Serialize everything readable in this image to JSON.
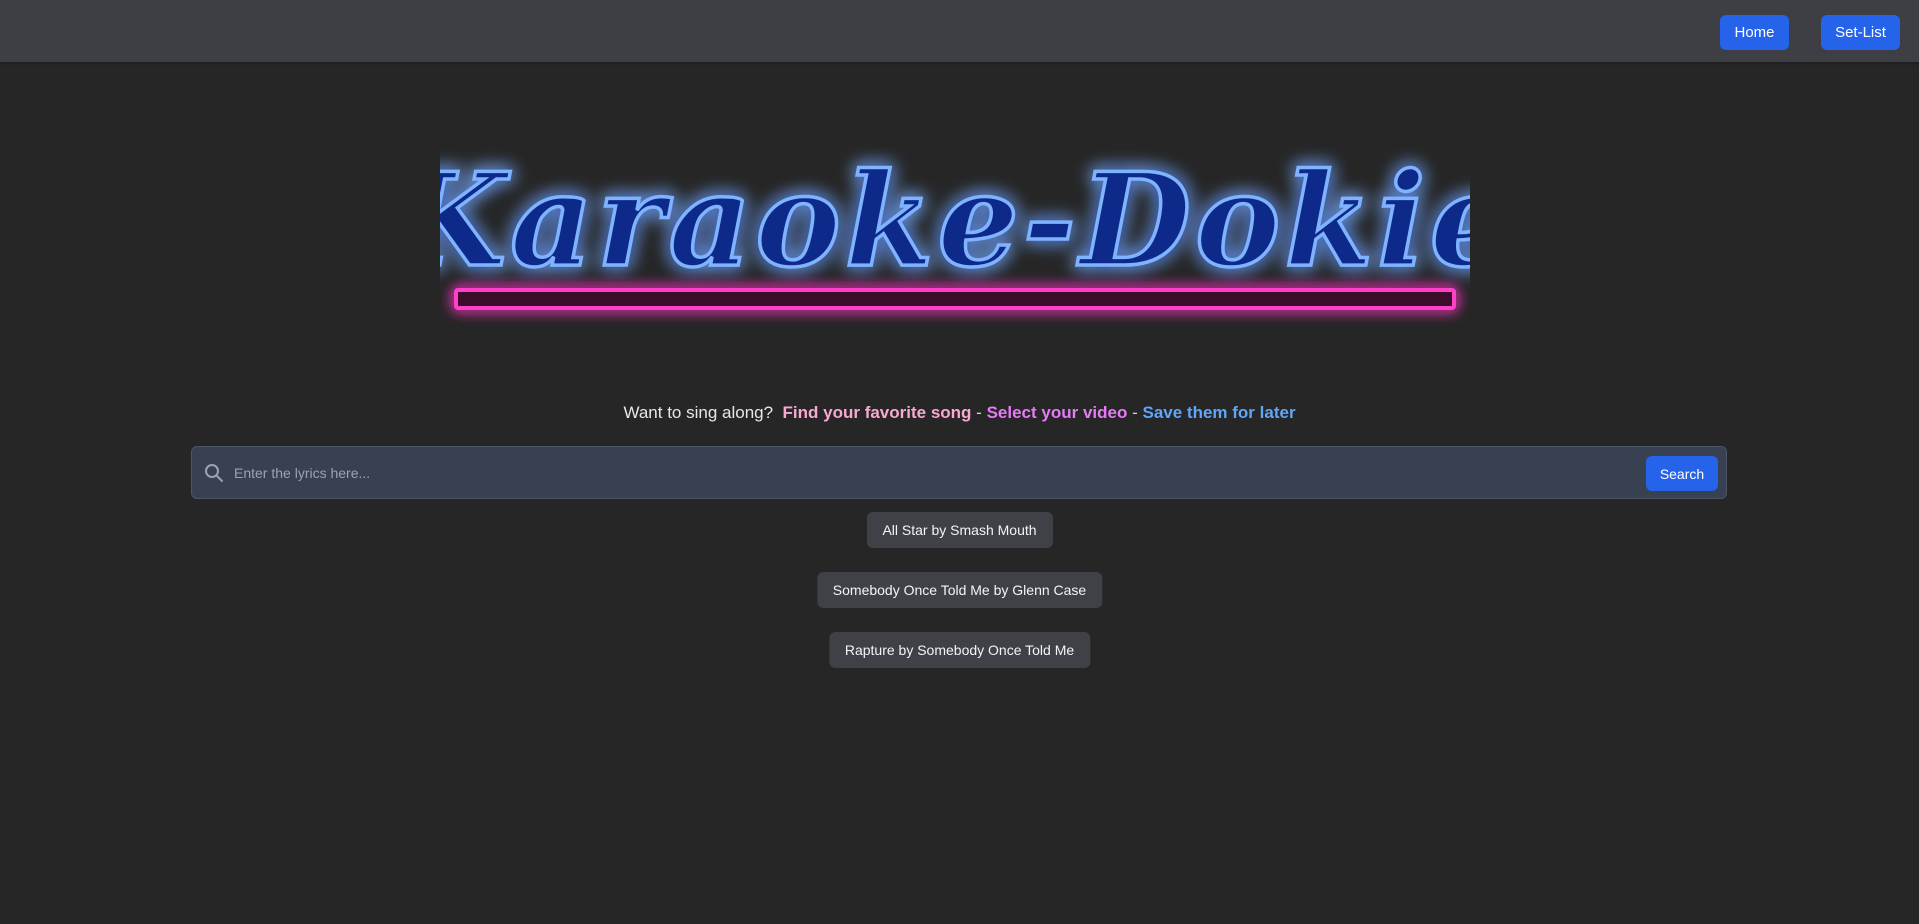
{
  "nav": {
    "home_label": "Home",
    "setlist_label": "Set-List"
  },
  "logo": {
    "text": "Karaoke-Dokie",
    "colors": {
      "neon_blue": "#3b82f6",
      "neon_pink": "#ff3fc8"
    }
  },
  "tagline": {
    "intro": "Want to sing along?",
    "step1": "Find your favorite song",
    "sep1": "-",
    "step2": "Select your video",
    "sep2": "-",
    "step3": "Save them for later"
  },
  "search": {
    "placeholder": "Enter the lyrics here...",
    "value": "",
    "button_label": "Search",
    "icon": "search-icon"
  },
  "suggestions": [
    {
      "label": "All Star by Smash Mouth"
    },
    {
      "label": "Somebody Once Told Me by Glenn Case"
    },
    {
      "label": "Rapture by Somebody Once Told Me"
    }
  ],
  "colors": {
    "background": "#262626",
    "topbar": "#3d3f45",
    "accent": "#2563eb"
  }
}
